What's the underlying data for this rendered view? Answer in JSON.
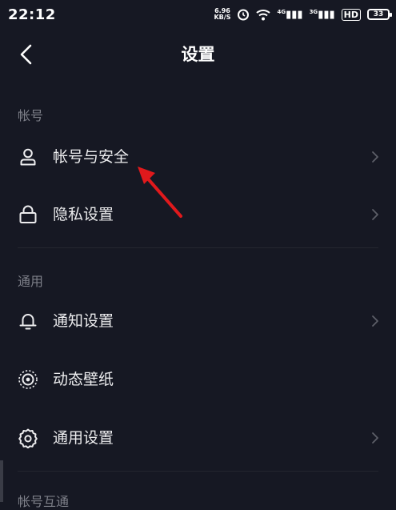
{
  "status_bar": {
    "time": "22:12",
    "net_speed_value": "6.96",
    "net_speed_unit": "KB/S",
    "sig1": "4G",
    "sig2": "3G",
    "hd": "HD",
    "battery": "33"
  },
  "nav": {
    "title": "设置"
  },
  "sections": {
    "account": {
      "header": "帐号",
      "items": [
        {
          "label": "帐号与安全",
          "icon": "user-icon"
        },
        {
          "label": "隐私设置",
          "icon": "lock-icon"
        }
      ]
    },
    "general": {
      "header": "通用",
      "items": [
        {
          "label": "通知设置",
          "icon": "bell-icon"
        },
        {
          "label": "动态壁纸",
          "icon": "wallpaper-icon"
        },
        {
          "label": "通用设置",
          "icon": "gear-icon"
        }
      ]
    },
    "interop": {
      "header": "帐号互通"
    }
  },
  "colors": {
    "background": "#161823",
    "text": "#ececee",
    "muted": "#7d7f88",
    "annotation": "#e0191c"
  }
}
